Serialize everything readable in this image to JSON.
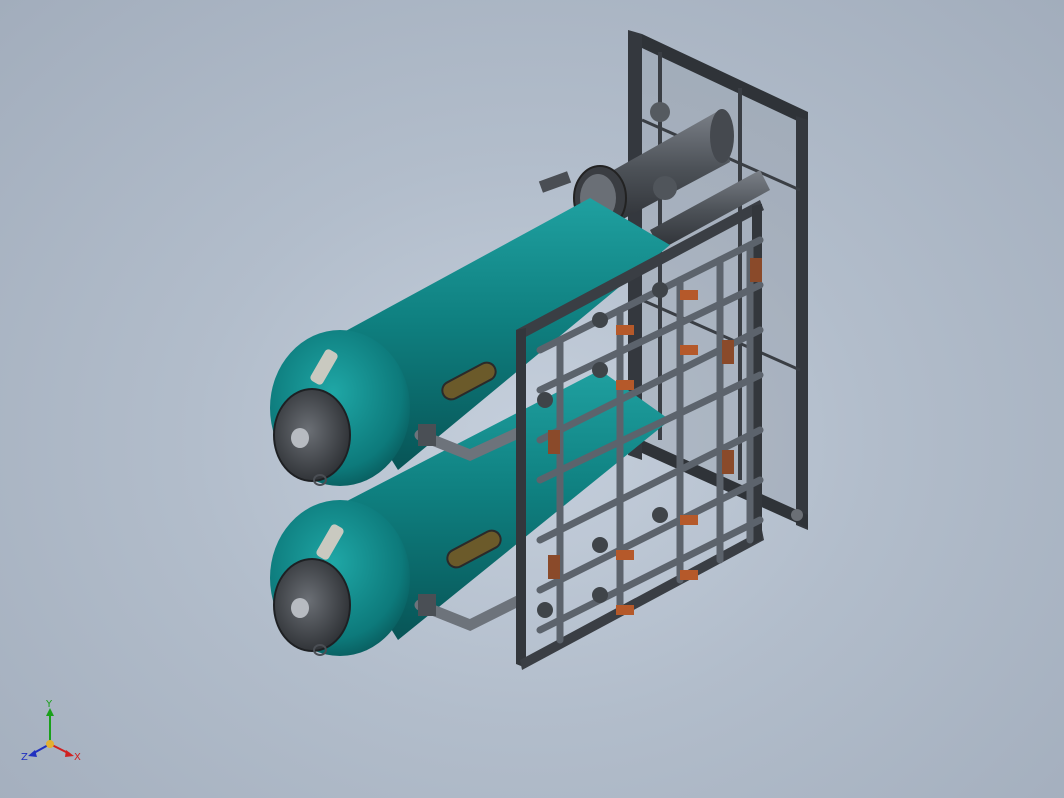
{
  "viewport": {
    "background": "#b8c3d0",
    "model": {
      "vessel_color": "#0e7c7f",
      "vessel_highlight": "#22a3a3",
      "frame_color": "#3b3f45",
      "pipe_color": "#5c636c",
      "valve_color": "#8a4a2a"
    }
  },
  "triad": {
    "y_label": "Y",
    "x_label": "X",
    "z_label": "Z",
    "y_color": "#1aa01a",
    "x_color": "#d02020",
    "z_color": "#2030c0"
  }
}
